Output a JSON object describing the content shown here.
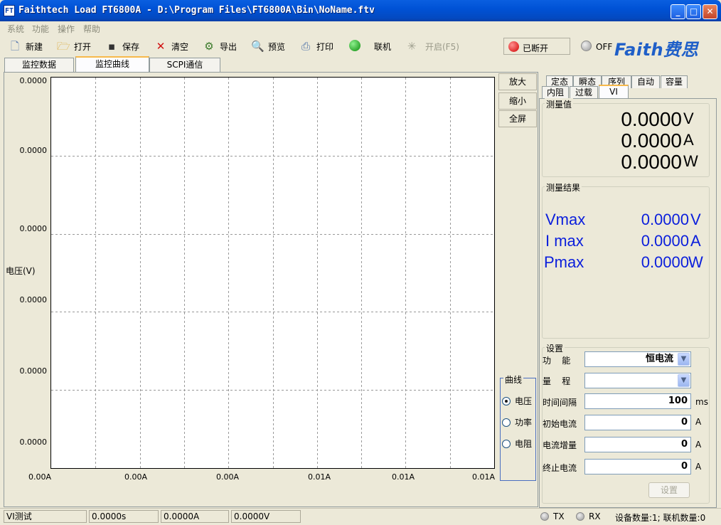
{
  "window": {
    "title": "Faithtech Load FT6800A - D:\\Program Files\\FT6800A\\Bin\\NoName.ftv",
    "icon_text": "FT"
  },
  "menu": [
    "系统",
    "功能",
    "操作",
    "帮助"
  ],
  "toolbar": {
    "new_label": "新建",
    "open_label": "打开",
    "save_label": "保存",
    "clear_label": "清空",
    "export_label": "导出",
    "preview_label": "预览",
    "print_label": "打印",
    "connect_label": "联机",
    "start_label": "开启(F5)"
  },
  "connection": {
    "status": "已断开",
    "power": "OFF"
  },
  "logo": "Faith费思",
  "tabs": [
    "监控数据",
    "监控曲线",
    "SCPI通信"
  ],
  "chart_data": {
    "type": "line",
    "ylabel": "电压(V)",
    "y_ticks": [
      "0.0000",
      "0.0000",
      "0.0000",
      "0.0000",
      "0.0000",
      "0.0000"
    ],
    "x_ticks": [
      "0.00A",
      "0.00A",
      "0.00A",
      "0.01A",
      "0.01A",
      "0.01A"
    ],
    "series": [],
    "grid": true
  },
  "zoom": {
    "zoom_in": "放大",
    "zoom_out": "缩小",
    "fullscreen": "全屏"
  },
  "curve": {
    "title": "曲线",
    "options": [
      "电压",
      "功率",
      "电阻"
    ],
    "selected": 0
  },
  "right_tabs": {
    "row1": [
      "定态",
      "瞬态",
      "序列",
      "自动",
      "容量"
    ],
    "row2": [
      "内阻",
      "过载",
      "VI"
    ]
  },
  "measure": {
    "title": "测量值",
    "voltage": "0.0000",
    "voltage_unit": "V",
    "current": "0.0000",
    "current_unit": "A",
    "power": "0.0000",
    "power_unit": "W"
  },
  "results": {
    "title": "测量结果",
    "vmax_label": "Vmax",
    "vmax": "0.0000",
    "vmax_unit": "V",
    "imax_label": "I max",
    "imax": "0.0000",
    "imax_unit": "A",
    "pmax_label": "Pmax",
    "pmax": "0.0000",
    "pmax_unit": "W"
  },
  "settings": {
    "title": "设置",
    "function_label": "功    能",
    "function_value": "恒电流",
    "range_label": "量    程",
    "range_value": "",
    "interval_label": "时间间隔",
    "interval_value": "100",
    "interval_unit": "ms",
    "start_current_label": "初始电流",
    "start_current_value": "0",
    "start_current_unit": "A",
    "step_current_label": "电流增量",
    "step_current_value": "0",
    "step_current_unit": "A",
    "end_current_label": "终止电流",
    "end_current_value": "0",
    "end_current_unit": "A",
    "apply_label": "设置"
  },
  "statusbar": {
    "mode": "VI测试",
    "time": "0.0000s",
    "current": "0.0000A",
    "voltage": "0.0000V",
    "tx": "TX",
    "rx": "RX",
    "devices": "设备数量:1; 联机数量:0"
  }
}
